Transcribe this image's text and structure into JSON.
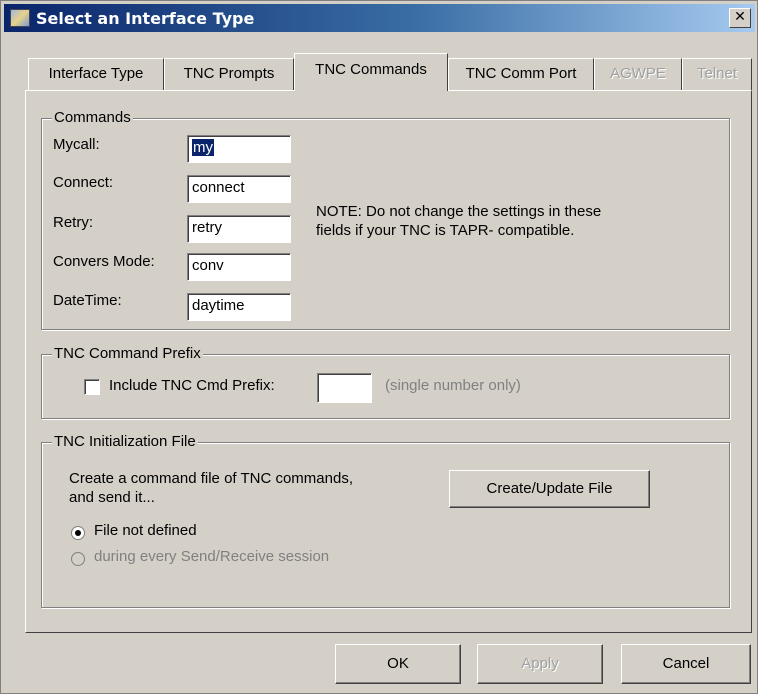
{
  "window": {
    "title": "Select an Interface Type"
  },
  "tabs": [
    {
      "label": "Interface Type"
    },
    {
      "label": "TNC Prompts"
    },
    {
      "label": "TNC Commands"
    },
    {
      "label": "TNC Comm Port"
    },
    {
      "label": "AGWPE"
    },
    {
      "label": "Telnet"
    }
  ],
  "commands": {
    "legend": "Commands",
    "fields": [
      {
        "label": "Mycall:",
        "value": "my"
      },
      {
        "label": "Connect:",
        "value": "connect"
      },
      {
        "label": "Retry:",
        "value": "retry"
      },
      {
        "label": "Convers Mode:",
        "value": "conv"
      },
      {
        "label": "DateTime:",
        "value": "daytime"
      }
    ],
    "note_line1": "NOTE:  Do not change the settings in these",
    "note_line2": "fields if your TNC is TAPR- compatible."
  },
  "prefix": {
    "legend": "TNC Command Prefix",
    "checkbox_label": "Include TNC Cmd Prefix:",
    "value": "",
    "hint": "(single number only)"
  },
  "init_file": {
    "legend": "TNC Initialization File",
    "desc_line1": "Create a command file of TNC commands,",
    "desc_line2": "and send it...",
    "create_button": "Create/Update File",
    "radio1": "File not defined",
    "radio2": "during every Send/Receive session"
  },
  "buttons": {
    "ok": "OK",
    "apply": "Apply",
    "cancel": "Cancel"
  }
}
